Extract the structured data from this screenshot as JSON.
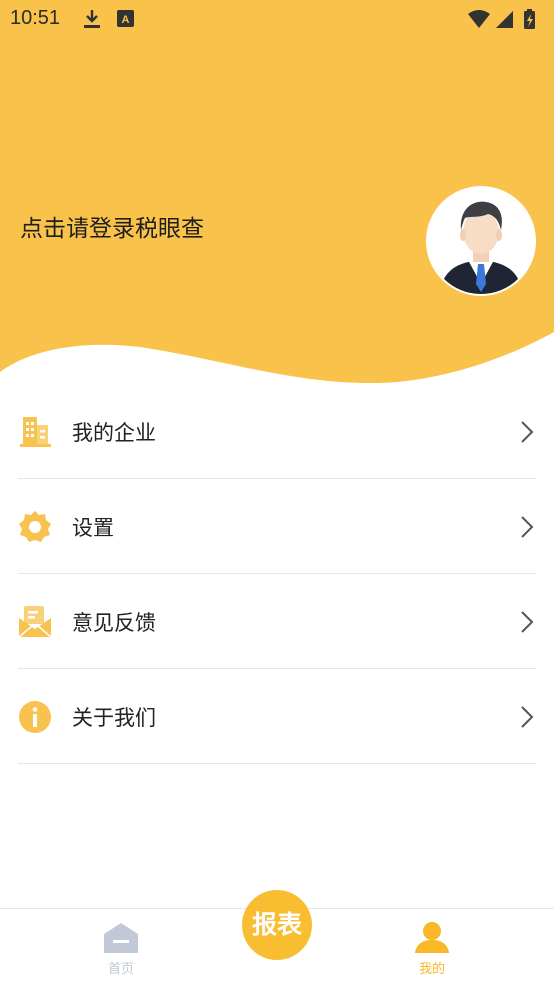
{
  "status_bar": {
    "time": "10:51",
    "note_icon_letter": "A"
  },
  "profile": {
    "login_prompt": "点击请登录税眼查"
  },
  "menu": [
    {
      "label": "我的企业",
      "icon": "building-icon"
    },
    {
      "label": "设置",
      "icon": "gear-icon"
    },
    {
      "label": "意见反馈",
      "icon": "feedback-icon"
    },
    {
      "label": "关于我们",
      "icon": "info-icon"
    }
  ],
  "tabbar": {
    "home_label": "首页",
    "report_label": "报表",
    "mine_label": "我的"
  },
  "colors": {
    "accent": "#f9c24a",
    "active": "#f9b827",
    "inactive": "#c3c8d6"
  }
}
